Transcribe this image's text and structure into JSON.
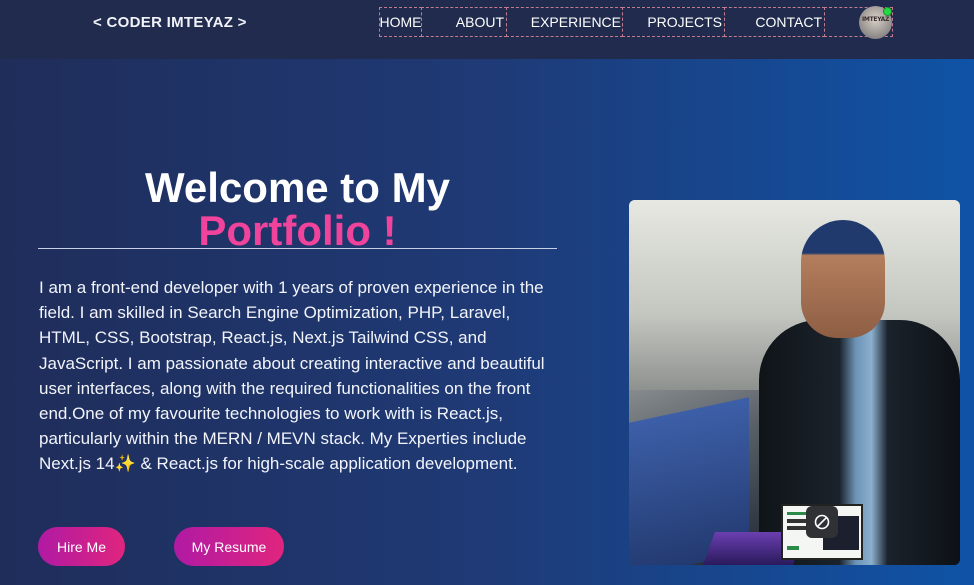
{
  "navbar": {
    "brand": "< CODER IMTEYAZ >",
    "items": [
      {
        "label": "HOME"
      },
      {
        "label": "ABOUT"
      },
      {
        "label": "EXPERIENCE"
      },
      {
        "label": "PROJECTS"
      },
      {
        "label": "CONTACT"
      }
    ],
    "avatar_text": "IMTEYAZ",
    "online_color": "#25d943"
  },
  "hero": {
    "title_line1": "Welcome to My",
    "title_line2": "Portfolio !",
    "intro": "I am a front-end developer with 1 years of proven experience in the field. I am skilled in Search Engine Optimization, PHP, Laravel, HTML, CSS, Bootstrap, React.js, Next.js Tailwind CSS, and JavaScript. I am passionate about creating interactive and beautiful user interfaces, along with the required functionalities on the front end.One of my favourite technologies to work with is React.js, particularly within the MERN / MEVN stack. My Experties include Next.js 14✨  & React.js for high-scale application development.",
    "buttons": {
      "hire": "Hire Me",
      "resume": "My Resume"
    },
    "accent_color": "#f0439b",
    "photo_icon": "block-icon"
  }
}
